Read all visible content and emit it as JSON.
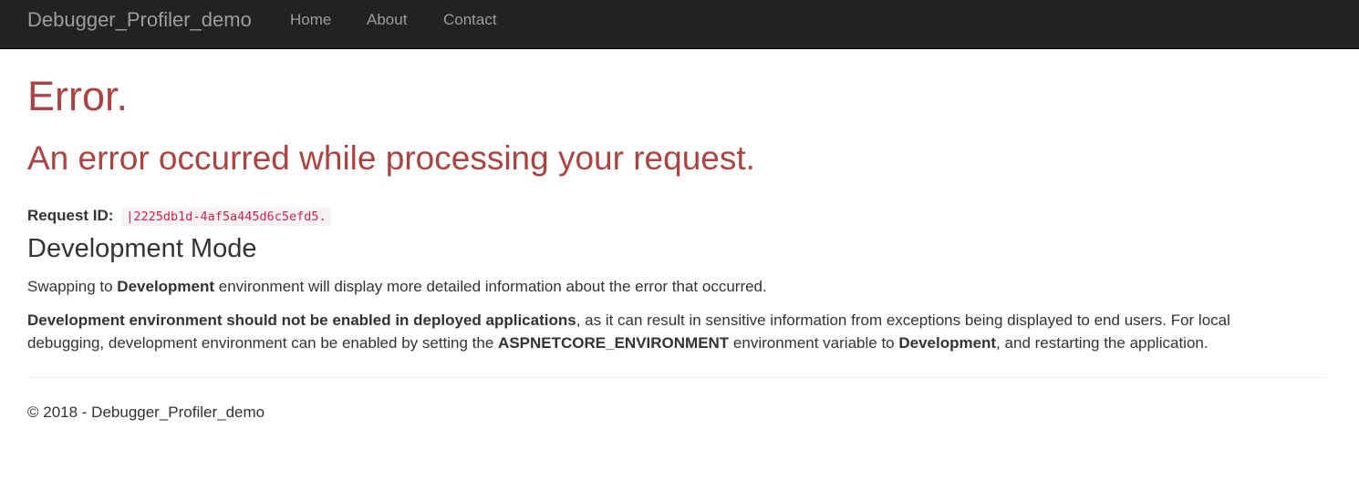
{
  "navbar": {
    "brand": "Debugger_Profiler_demo",
    "links": [
      "Home",
      "About",
      "Contact"
    ]
  },
  "error": {
    "title": "Error.",
    "subtitle": "An error occurred while processing your request.",
    "request_id_label": "Request ID:",
    "request_id_value": "|2225db1d-4af5a445d6c5efd5."
  },
  "dev_mode": {
    "heading": "Development Mode",
    "p1": {
      "before": "Swapping to ",
      "bold": "Development",
      "after": " environment will display more detailed information about the error that occurred."
    },
    "p2": {
      "bold1": "Development environment should not be enabled in deployed applications",
      "text1": ", as it can result in sensitive information from exceptions being displayed to end users. For local debugging, development environment can be enabled by setting the ",
      "bold2": "ASPNETCORE_ENVIRONMENT",
      "text2": " environment variable to ",
      "bold3": "Development",
      "text3": ", and restarting the application."
    }
  },
  "footer": {
    "text": "© 2018 - Debugger_Profiler_demo"
  },
  "colors": {
    "navbar_bg": "#222222",
    "nav_text": "#9d9d9d",
    "error_red": "#a94442",
    "code_text": "#c7254e",
    "code_bg": "#f9f2f4",
    "body_text": "#333333"
  }
}
